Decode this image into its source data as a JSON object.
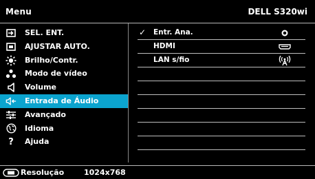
{
  "header": {
    "title": "Menu",
    "model": "DELL S320wi"
  },
  "menu": {
    "items": [
      {
        "label": "SEL. ENT.",
        "icon": "input-select-icon"
      },
      {
        "label": "AJUSTAR AUTO.",
        "icon": "auto-adjust-icon"
      },
      {
        "label": "Brilho/Contr.",
        "icon": "brightness-icon"
      },
      {
        "label": "Modo de vídeo",
        "icon": "video-mode-icon"
      },
      {
        "label": "Volume",
        "icon": "volume-icon"
      },
      {
        "label": "Entrada de Áudio",
        "icon": "audio-input-icon"
      },
      {
        "label": "Avançado",
        "icon": "advanced-settings-icon"
      },
      {
        "label": "Idioma",
        "icon": "language-icon"
      },
      {
        "label": "Ajuda",
        "icon": "help-icon"
      }
    ],
    "selected_index": 5,
    "selected_color": "#0ba4cf"
  },
  "options": {
    "items": [
      {
        "label": "Entr. Ana.",
        "checked": true,
        "icon": "analog-jack-icon"
      },
      {
        "label": "HDMI",
        "checked": false,
        "icon": "hdmi-port-icon"
      },
      {
        "label": "LAN s/fio",
        "checked": false,
        "icon": "wireless-antenna-icon"
      }
    ],
    "check_glyph": "✓"
  },
  "footer": {
    "label": "Resolução",
    "value": "1024x768",
    "icon": "resolution-icon"
  }
}
